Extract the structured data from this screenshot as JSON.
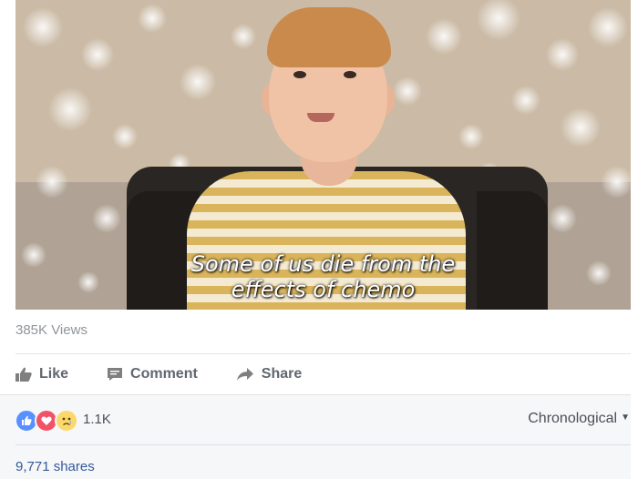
{
  "video": {
    "caption_line1": "Some of us die from the",
    "caption_line2": "effects of chemo"
  },
  "stats": {
    "views": "385K Views"
  },
  "actions": {
    "like_label": "Like",
    "comment_label": "Comment",
    "share_label": "Share"
  },
  "reactions": {
    "count": "1.1K",
    "icons": [
      "like-icon",
      "love-icon",
      "sad-icon"
    ],
    "sort_label": "Chronological"
  },
  "shares": {
    "label": "9,771 shares"
  },
  "colors": {
    "link": "#365899",
    "muted": "#90949c",
    "action": "#616770",
    "like": "#5890ff",
    "love": "#f25268",
    "sad": "#fcd86c"
  }
}
